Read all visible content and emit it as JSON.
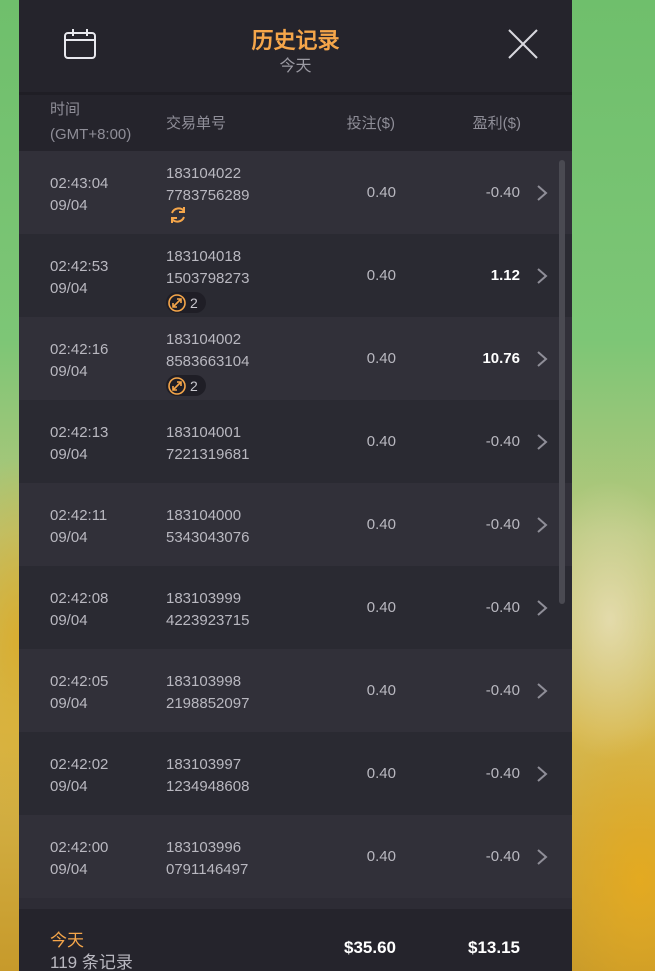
{
  "header": {
    "title": "历史记录",
    "subtitle": "今天"
  },
  "columns": {
    "time": "时间",
    "timezone": "(GMT+8:00)",
    "order": "交易单号",
    "bet": "投注($)",
    "win": "盈利($)"
  },
  "rows": [
    {
      "time": "02:43:04",
      "date": "09/04",
      "order1": "183104022",
      "order2": "7783756289",
      "bet": "0.40",
      "win": "-0.40",
      "badge": "refresh-icon",
      "badge_count": ""
    },
    {
      "time": "02:42:53",
      "date": "09/04",
      "order1": "183104018",
      "order2": "1503798273",
      "bet": "0.40",
      "win": "1.12",
      "badge": "expand-icon",
      "badge_count": "2"
    },
    {
      "time": "02:42:16",
      "date": "09/04",
      "order1": "183104002",
      "order2": "8583663104",
      "bet": "0.40",
      "win": "10.76",
      "badge": "expand-icon",
      "badge_count": "2"
    },
    {
      "time": "02:42:13",
      "date": "09/04",
      "order1": "183104001",
      "order2": "7221319681",
      "bet": "0.40",
      "win": "-0.40"
    },
    {
      "time": "02:42:11",
      "date": "09/04",
      "order1": "183104000",
      "order2": "5343043076",
      "bet": "0.40",
      "win": "-0.40"
    },
    {
      "time": "02:42:08",
      "date": "09/04",
      "order1": "183103999",
      "order2": "4223923715",
      "bet": "0.40",
      "win": "-0.40"
    },
    {
      "time": "02:42:05",
      "date": "09/04",
      "order1": "183103998",
      "order2": "2198852097",
      "bet": "0.40",
      "win": "-0.40"
    },
    {
      "time": "02:42:02",
      "date": "09/04",
      "order1": "183103997",
      "order2": "1234948608",
      "bet": "0.40",
      "win": "-0.40"
    },
    {
      "time": "02:42:00",
      "date": "09/04",
      "order1": "183103996",
      "order2": "0791146497",
      "bet": "0.40",
      "win": "-0.40"
    }
  ],
  "footer": {
    "today": "今天",
    "count": "119 条记录",
    "total_bet": "$35.60",
    "total_win": "$13.15"
  },
  "colors": {
    "accent": "#f5a64a",
    "panel": "#2d2c35",
    "header": "#25242c"
  }
}
